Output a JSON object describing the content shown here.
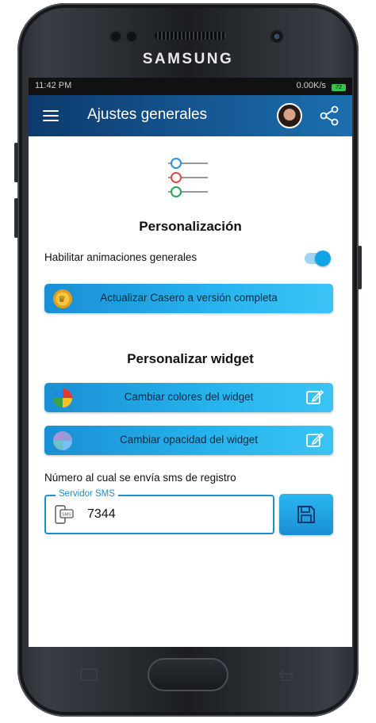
{
  "device": {
    "brand": "SAMSUNG"
  },
  "statusbar": {
    "time": "11:42 PM",
    "right_text": "0.00K/s",
    "battery": "72"
  },
  "appbar": {
    "title": "Ajustes generales"
  },
  "icons": {
    "menu": "hamburger-menu-icon",
    "avatar": "user-avatar",
    "share": "share-icon",
    "sliders": "sliders-icon",
    "crown": "crown-icon",
    "palette": "color-wheel-icon",
    "opacity": "opacity-wheel-icon",
    "edit": "edit-icon",
    "sms": "phone-sms-icon",
    "save": "floppy-save-icon"
  },
  "colors": {
    "accent": "#1a8fd4",
    "appbar_start": "#0d3a6d",
    "appbar_end": "#1c6fb0",
    "toggle_on": "#13a4e8"
  },
  "personalization": {
    "title": "Personalización",
    "animations_label": "Habilitar animaciones generales",
    "animations_enabled": true,
    "upgrade_button": "Actualizar Casero a versión completa"
  },
  "widget": {
    "title": "Personalizar widget",
    "colors_button": "Cambiar colores del widget",
    "opacity_button": "Cambiar opacidad del widget"
  },
  "sms": {
    "description": "Número al cual se envía sms de registro",
    "field_label": "Servidor SMS",
    "value": "7344"
  }
}
